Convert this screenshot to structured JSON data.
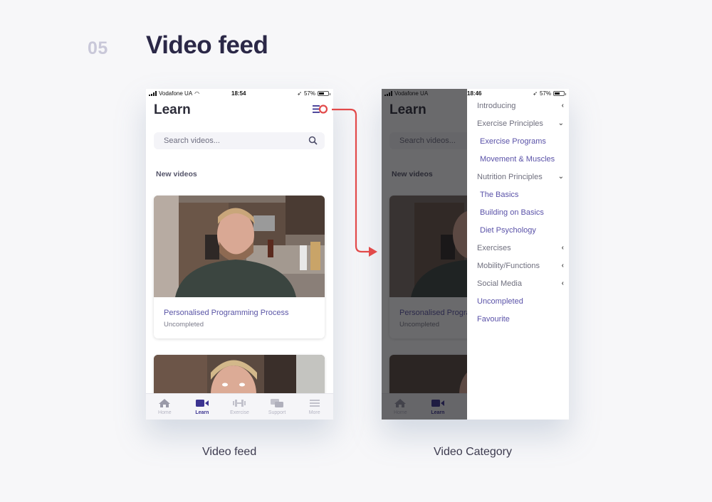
{
  "header": {
    "section_number": "05",
    "section_title": "Video feed"
  },
  "captions": {
    "left": "Video feed",
    "right": "Video Category"
  },
  "accent_colors": {
    "brand_purple": "#3c3491",
    "link_purple": "#5a52a8",
    "annotation_red": "#e24a4a"
  },
  "phone1": {
    "status": {
      "carrier": "Vodafone UA",
      "time": "18:54",
      "battery": "57%"
    },
    "app_title": "Learn",
    "menu_icon": "hamburger-menu-icon",
    "search": {
      "placeholder": "Search videos...",
      "icon": "search-icon"
    },
    "section_label": "New videos",
    "videos": [
      {
        "title": "Personalised Programming Process",
        "status": "Uncompleted"
      },
      {
        "title": "",
        "status": ""
      }
    ],
    "tabs": [
      {
        "label": "Home",
        "icon": "home-icon",
        "active": false
      },
      {
        "label": "Learn",
        "icon": "video-camera-icon",
        "active": true
      },
      {
        "label": "Exercise",
        "icon": "dumbbell-icon",
        "active": false
      },
      {
        "label": "Support",
        "icon": "chat-bubbles-icon",
        "active": false
      },
      {
        "label": "More",
        "icon": "menu-lines-icon",
        "active": false
      }
    ]
  },
  "phone2": {
    "status": {
      "carrier": "Vodafone UA",
      "time": "18:46",
      "battery": "57%"
    },
    "app_title": "Learn",
    "search": {
      "placeholder": "Search videos..."
    },
    "section_label": "New videos",
    "videos": [
      {
        "title": "Personalised Programming Process",
        "status": "Uncompleted"
      }
    ],
    "tabs": [
      {
        "label": "Home"
      },
      {
        "label": "Learn"
      }
    ],
    "drawer": [
      {
        "label": "Introducing",
        "type": "category",
        "chevron": "‹"
      },
      {
        "label": "Exercise Principles",
        "type": "category",
        "chevron": "⌄"
      },
      {
        "label": "Exercise Programs",
        "type": "sub"
      },
      {
        "label": "Movement & Muscles",
        "type": "sub"
      },
      {
        "label": "Nutrition Principles",
        "type": "category",
        "chevron": "⌄"
      },
      {
        "label": "The Basics",
        "type": "sub"
      },
      {
        "label": "Building on Basics",
        "type": "sub"
      },
      {
        "label": "Diet Psychology",
        "type": "sub"
      },
      {
        "label": "Exercises",
        "type": "category",
        "chevron": "‹"
      },
      {
        "label": "Mobility/Functions",
        "type": "category",
        "chevron": "‹"
      },
      {
        "label": "Social Media",
        "type": "category",
        "chevron": "‹"
      },
      {
        "label": "Uncompleted",
        "type": "link"
      },
      {
        "label": "Favourite",
        "type": "link"
      }
    ]
  }
}
